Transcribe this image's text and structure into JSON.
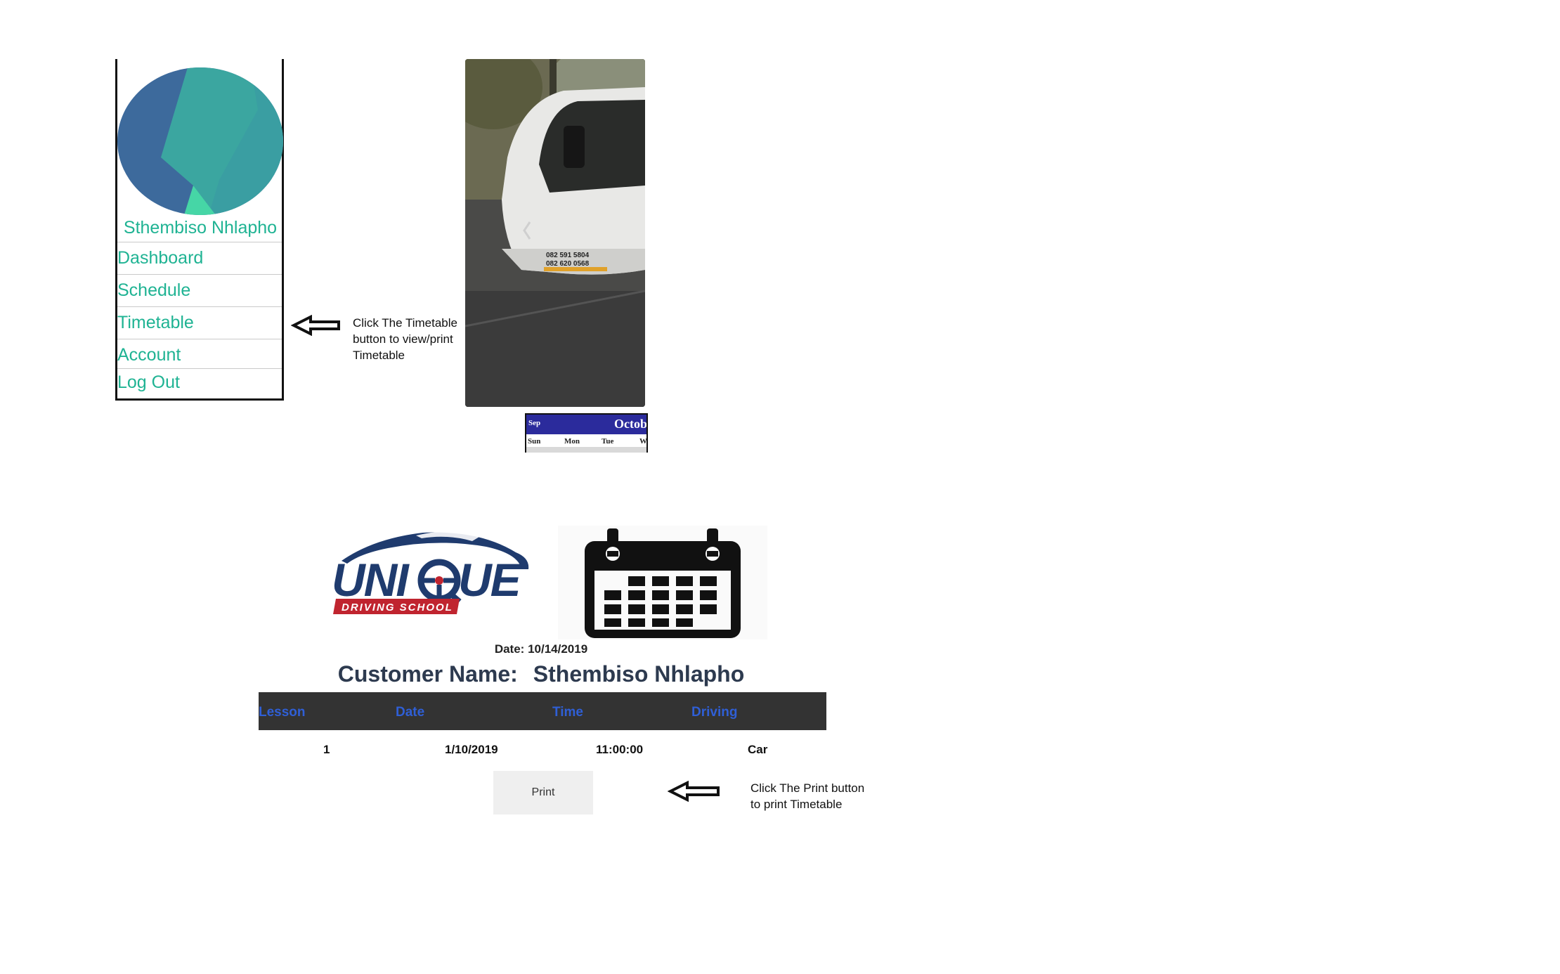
{
  "sidebar": {
    "profile_name": "Sthembiso Nhlapho",
    "items": [
      {
        "label": "Dashboard"
      },
      {
        "label": "Schedule"
      },
      {
        "label": "Timetable"
      },
      {
        "label": "Account"
      },
      {
        "label": "Log Out"
      }
    ]
  },
  "annotations": {
    "timetable_hint": [
      "Click The Timetable",
      "button to view/print",
      "Timetable"
    ],
    "print_hint": [
      "Click The Print button",
      "to print Timetable"
    ],
    "arrow_icon": "left-arrow-icon"
  },
  "photo": {
    "phone_line_1": "082 591 5804",
    "phone_line_2": "082 620 0568",
    "icon": "car-photo"
  },
  "mini_calendar": {
    "prev_month": "Sep",
    "month": "October",
    "days": [
      "Sun",
      "Mon",
      "Tue",
      "Wed"
    ]
  },
  "logo": {
    "brand": "UNIQUE",
    "tagline": "DRIVING SCHOOL",
    "colors": {
      "navy": "#1f3b6e",
      "red": "#c0242f"
    }
  },
  "calendar_icon": "calendar-icon",
  "timetable": {
    "date_label": "Date:",
    "date_value": "10/14/2019",
    "customer_label": "Customer Name:",
    "customer_name": "Sthembiso Nhlapho",
    "columns": [
      "Lesson",
      "Date",
      "Time",
      "Driving"
    ],
    "rows": [
      {
        "lesson": "1",
        "date": "1/10/2019",
        "time": "11:00:00",
        "driving": "Car"
      }
    ],
    "print_label": "Print"
  },
  "colors": {
    "accent_teal": "#1fb393",
    "table_header_bg": "#333333",
    "table_header_text": "#2f5fd6"
  }
}
